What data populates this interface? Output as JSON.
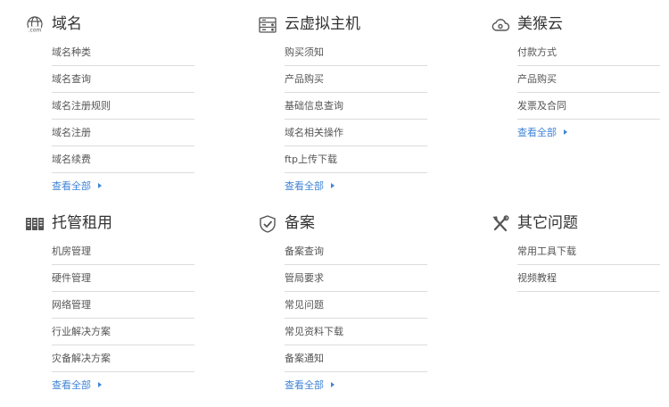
{
  "sections": [
    {
      "icon": "globe-com-icon",
      "title": "域名",
      "items": [
        "域名种类",
        "域名查询",
        "域名注册规则",
        "域名注册",
        "域名续费"
      ],
      "more": "查看全部"
    },
    {
      "icon": "server-host-icon",
      "title": "云虚拟主机",
      "items": [
        "购买须知",
        "产品购买",
        "基础信息查询",
        "域名相关操作",
        "ftp上传下载"
      ],
      "more": "查看全部"
    },
    {
      "icon": "cloud-icon",
      "title": "美猴云",
      "items": [
        "付款方式",
        "产品购买",
        "发票及合同"
      ],
      "more": "查看全部"
    },
    {
      "icon": "server-rack-icon",
      "title": "托管租用",
      "items": [
        "机房管理",
        "硬件管理",
        "网络管理",
        "行业解决方案",
        "灾备解决方案"
      ],
      "more": "查看全部"
    },
    {
      "icon": "shield-check-icon",
      "title": "备案",
      "items": [
        "备案查询",
        "管局要求",
        "常见问题",
        "常见资料下载",
        "备案通知"
      ],
      "more": "查看全部"
    },
    {
      "icon": "tools-icon",
      "title": "其它问题",
      "items": [
        "常用工具下载",
        "视频教程"
      ],
      "more": ""
    }
  ],
  "icon_text": {
    "com": ".com"
  },
  "colors": {
    "link": "#3f84d6",
    "divider": "#dcdcdc",
    "text": "#555555",
    "title": "#333333"
  }
}
